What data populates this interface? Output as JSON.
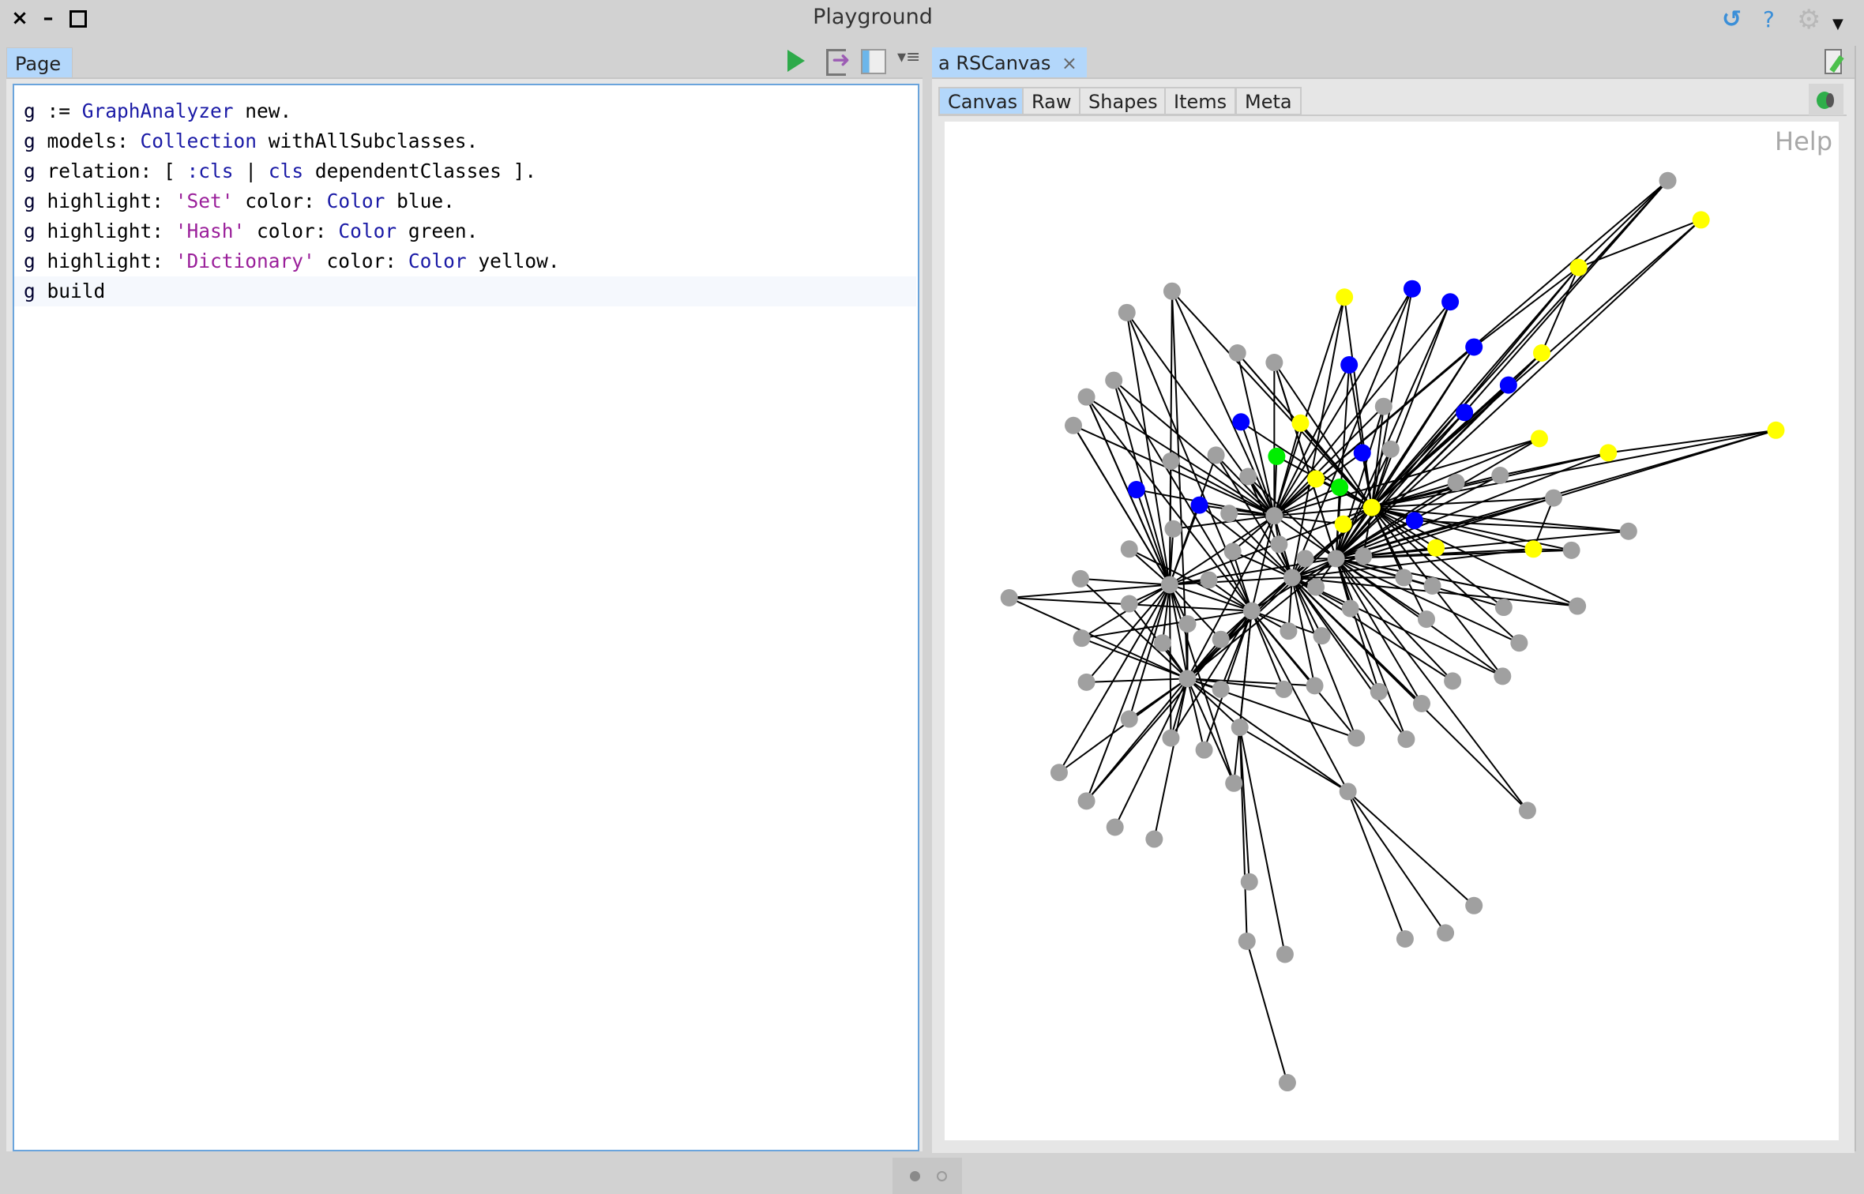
{
  "window": {
    "title": "Playground",
    "controls": [
      "close",
      "minimize",
      "maximize"
    ],
    "close_glyph": "×",
    "minimize_glyph": "–",
    "maximize_glyph": "□",
    "top_right_icons": [
      {
        "name": "refresh-icon",
        "glyph": "↺",
        "color": "#3b8fd8"
      },
      {
        "name": "help-icon",
        "glyph": "?",
        "color": "#3b8fd8"
      },
      {
        "name": "gear-icon",
        "glyph": "⚙",
        "color": "#b8b8b8"
      },
      {
        "name": "dropdown-arrow-icon",
        "glyph": "▼",
        "color": "#111111"
      }
    ]
  },
  "left_pane": {
    "tab_label": "Page",
    "toolbar": [
      {
        "name": "run-icon",
        "glyph": "▶",
        "color": "#2eaa4a"
      },
      {
        "name": "export-icon",
        "glyph": "➜",
        "color": "#9c5cb4"
      },
      {
        "name": "bindings-icon",
        "glyph": "▥",
        "color": "#4aa3df"
      },
      {
        "name": "menu-icon",
        "glyph": "▾≡",
        "color": "#555555"
      }
    ],
    "code_lines": [
      [
        {
          "t": "g",
          "c": "g"
        },
        {
          "t": " := ",
          "c": "plain"
        },
        {
          "t": "GraphAnalyzer",
          "c": "cls"
        },
        {
          "t": " new.",
          "c": "plain"
        }
      ],
      [
        {
          "t": "g",
          "c": "g"
        },
        {
          "t": " models: ",
          "c": "plain"
        },
        {
          "t": "Collection",
          "c": "cls"
        },
        {
          "t": " withAllSubclasses.",
          "c": "plain"
        }
      ],
      [
        {
          "t": "g",
          "c": "g"
        },
        {
          "t": " relation: [ ",
          "c": "plain"
        },
        {
          "t": ":cls",
          "c": "sym"
        },
        {
          "t": " | ",
          "c": "plain"
        },
        {
          "t": "cls",
          "c": "sym"
        },
        {
          "t": " dependentClasses ].",
          "c": "plain"
        }
      ],
      [
        {
          "t": "g",
          "c": "g"
        },
        {
          "t": " highlight: ",
          "c": "plain"
        },
        {
          "t": "'Set'",
          "c": "str"
        },
        {
          "t": " color: ",
          "c": "plain"
        },
        {
          "t": "Color",
          "c": "cls"
        },
        {
          "t": " blue.",
          "c": "plain"
        }
      ],
      [
        {
          "t": "g",
          "c": "g"
        },
        {
          "t": " highlight: ",
          "c": "plain"
        },
        {
          "t": "'Hash'",
          "c": "str"
        },
        {
          "t": " color: ",
          "c": "plain"
        },
        {
          "t": "Color",
          "c": "cls"
        },
        {
          "t": " green.",
          "c": "plain"
        }
      ],
      [
        {
          "t": "g",
          "c": "g"
        },
        {
          "t": " highlight: ",
          "c": "plain"
        },
        {
          "t": "'Dictionary'",
          "c": "str"
        },
        {
          "t": " color: ",
          "c": "plain"
        },
        {
          "t": "Color",
          "c": "cls"
        },
        {
          "t": " yellow.",
          "c": "plain"
        }
      ],
      [
        {
          "t": "g",
          "c": "g"
        },
        {
          "t": " build",
          "c": "plain"
        }
      ]
    ]
  },
  "right_pane": {
    "tab_label": "a RSCanvas",
    "tab_close_glyph": "×",
    "subtabs": [
      "Canvas",
      "Raw",
      "Shapes",
      "Items",
      "Meta"
    ],
    "active_subtab": "Canvas",
    "edit_icon": "edit-document-icon",
    "bug_icon": "bug-icon",
    "help_label": "Help"
  },
  "graph": {
    "colors": {
      "gray": "#a0a0a0",
      "blue": "#0000ff",
      "green": "#00ee00",
      "yellow": "#ffff00",
      "edge": "#000000"
    },
    "node_colors": [
      "gray",
      "yellow",
      "yellow",
      "blue",
      "blue",
      "yellow",
      "gray",
      "gray",
      "gray",
      "gray",
      "blue",
      "blue",
      "blue",
      "yellow",
      "gray",
      "gray",
      "gray",
      "blue",
      "gray",
      "yellow",
      "blue",
      "yellow",
      "gray",
      "green",
      "gray",
      "blue",
      "gray",
      "gray",
      "yellow",
      "gray",
      "green",
      "yellow",
      "blue",
      "yellow",
      "gray",
      "gray",
      "blue",
      "blue",
      "gray",
      "gray",
      "gray",
      "yellow",
      "yellow",
      "gray",
      "gray",
      "gray",
      "gray",
      "gray",
      "gray",
      "gray",
      "yellow",
      "yellow",
      "gray",
      "gray",
      "gray",
      "gray",
      "gray",
      "gray",
      "gray",
      "gray",
      "gray",
      "gray",
      "gray",
      "gray",
      "gray",
      "gray",
      "gray",
      "gray",
      "gray",
      "gray",
      "gray",
      "gray",
      "gray",
      "gray",
      "gray",
      "gray",
      "gray",
      "gray",
      "gray",
      "gray",
      "gray",
      "gray",
      "gray",
      "gray",
      "gray",
      "gray",
      "gray",
      "gray",
      "gray",
      "gray",
      "gray",
      "gray",
      "gray",
      "gray"
    ],
    "node_count": 94
  },
  "pager": {
    "pages": 2,
    "current": 1
  }
}
